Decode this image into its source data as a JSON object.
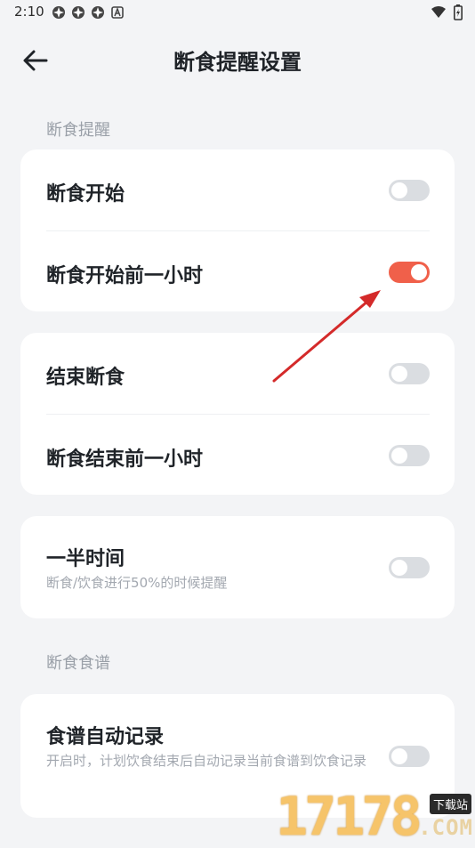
{
  "status_bar": {
    "time": "2:10"
  },
  "header": {
    "title": "断食提醒设置"
  },
  "sections": [
    {
      "label": "断食提醒"
    },
    {
      "label": "断食食谱"
    }
  ],
  "cards": [
    {
      "rows": [
        {
          "title": "断食开始",
          "toggle_on": false
        },
        {
          "title": "断食开始前一小时",
          "toggle_on": true
        }
      ]
    },
    {
      "rows": [
        {
          "title": "结束断食",
          "toggle_on": false
        },
        {
          "title": "断食结束前一小时",
          "toggle_on": false
        }
      ]
    },
    {
      "rows": [
        {
          "title": "一半时间",
          "subtitle": "断食/饮食进行50%的时候提醒",
          "toggle_on": false
        }
      ]
    },
    {
      "rows": [
        {
          "title": "食谱自动记录",
          "subtitle": "开启时，计划饮食结束后自动记录当前食谱到饮食记录",
          "toggle_on": false
        }
      ]
    }
  ],
  "watermark": {
    "digits": "17178",
    "badge": "下载站",
    "domain": ".COM"
  },
  "colors": {
    "accent": "#f0604a",
    "toggle_off": "#dadde1",
    "annotation_arrow": "#d42a2a",
    "background": "#f3f4f6"
  }
}
